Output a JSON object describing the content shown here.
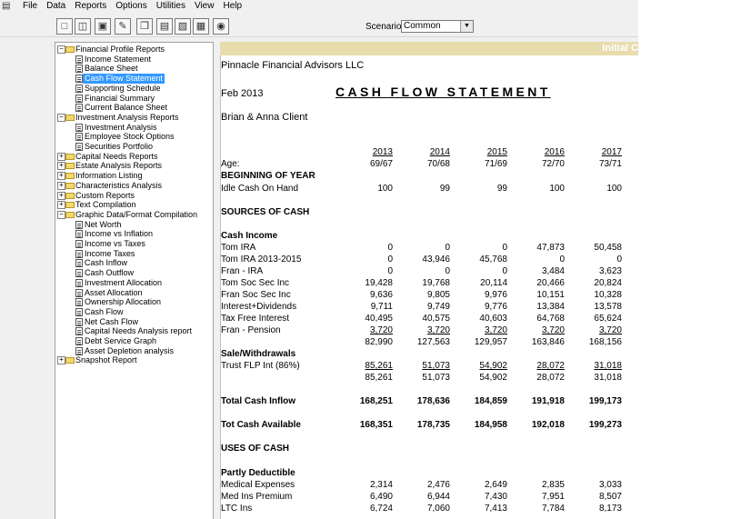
{
  "menu": {
    "app_icon": "app-icon",
    "items": [
      "File",
      "Data",
      "Reports",
      "Options",
      "Utilities",
      "View",
      "Help"
    ]
  },
  "toolbar": {
    "buttons": [
      "new-icon",
      "open-icon",
      "save-icon",
      "edit-icon",
      "copy-icon",
      "report-icon",
      "export-icon",
      "camera-icon"
    ]
  },
  "scenario": {
    "label": "Scenario:",
    "value": "Common"
  },
  "tree": [
    {
      "label": "Financial Profile Reports",
      "level": 0,
      "type": "folder",
      "toggle": "−"
    },
    {
      "label": "Income Statement",
      "level": 1,
      "type": "doc"
    },
    {
      "label": "Balance Sheet",
      "level": 1,
      "type": "doc"
    },
    {
      "label": "Cash Flow Statement",
      "level": 1,
      "type": "doc",
      "selected": true
    },
    {
      "label": "Supporting Schedule",
      "level": 1,
      "type": "doc"
    },
    {
      "label": "Financial Summary",
      "level": 1,
      "type": "doc"
    },
    {
      "label": "Current Balance Sheet",
      "level": 1,
      "type": "doc"
    },
    {
      "label": "Investment Analysis Reports",
      "level": 0,
      "type": "folder",
      "toggle": "−"
    },
    {
      "label": "Investment Analysis",
      "level": 1,
      "type": "doc"
    },
    {
      "label": "Employee Stock Options",
      "level": 1,
      "type": "doc"
    },
    {
      "label": "Securities Portfolio",
      "level": 1,
      "type": "doc"
    },
    {
      "label": "Capital Needs Reports",
      "level": 0,
      "type": "folder",
      "toggle": "+"
    },
    {
      "label": "Estate Analysis Reports",
      "level": 0,
      "type": "folder",
      "toggle": "+"
    },
    {
      "label": "Information Listing",
      "level": 0,
      "type": "folder",
      "toggle": "+"
    },
    {
      "label": "Characteristics Analysis",
      "level": 0,
      "type": "folder",
      "toggle": "+"
    },
    {
      "label": "Custom Reports",
      "level": 0,
      "type": "folder",
      "toggle": "+"
    },
    {
      "label": "Text Compilation",
      "level": 0,
      "type": "folder",
      "toggle": "+"
    },
    {
      "label": "Graphic Data/Format Compilation",
      "level": 0,
      "type": "folder",
      "toggle": "−"
    },
    {
      "label": "Net Worth",
      "level": 1,
      "type": "doc"
    },
    {
      "label": "Income vs Inflation",
      "level": 1,
      "type": "doc"
    },
    {
      "label": "Income vs Taxes",
      "level": 1,
      "type": "doc"
    },
    {
      "label": "Income Taxes",
      "level": 1,
      "type": "doc"
    },
    {
      "label": "Cash Inflow",
      "level": 1,
      "type": "doc"
    },
    {
      "label": "Cash Outflow",
      "level": 1,
      "type": "doc"
    },
    {
      "label": "Investment Allocation",
      "level": 1,
      "type": "doc"
    },
    {
      "label": "Asset Allocation",
      "level": 1,
      "type": "doc"
    },
    {
      "label": "Ownership Allocation",
      "level": 1,
      "type": "doc"
    },
    {
      "label": "Cash Flow",
      "level": 1,
      "type": "doc"
    },
    {
      "label": "Net Cash Flow",
      "level": 1,
      "type": "doc"
    },
    {
      "label": "Capital Needs Analysis report",
      "level": 1,
      "type": "doc"
    },
    {
      "label": "Debt Service Graph",
      "level": 1,
      "type": "doc"
    },
    {
      "label": "Asset Depletion analysis",
      "level": 1,
      "type": "doc"
    },
    {
      "label": "Snapshot Report",
      "level": 0,
      "type": "folder",
      "toggle": "+"
    }
  ],
  "report": {
    "banner": "Initial C",
    "firm": "Pinnacle Financial Advisors LLC",
    "date": "Feb 2013",
    "title": "CASH FLOW STATEMENT",
    "client": "Brian & Anna Client",
    "age_label": "Age:",
    "years": [
      "2013",
      "2014",
      "2015",
      "2016",
      "2017"
    ],
    "ages": [
      "69/67",
      "70/68",
      "71/69",
      "72/70",
      "73/71"
    ],
    "rows": [
      {
        "kind": "label",
        "text": "BEGINNING OF YEAR",
        "bold": true
      },
      {
        "kind": "row",
        "text": "Idle Cash On Hand",
        "values": [
          "100",
          "99",
          "99",
          "100",
          "100"
        ]
      },
      {
        "kind": "section",
        "text": "SOURCES OF CASH"
      },
      {
        "kind": "label",
        "text": "Cash Income",
        "bold": true
      },
      {
        "kind": "row",
        "text": "Tom IRA",
        "values": [
          "0",
          "0",
          "0",
          "47,873",
          "50,458"
        ]
      },
      {
        "kind": "row",
        "text": "Tom IRA 2013-2015",
        "values": [
          "0",
          "43,946",
          "45,768",
          "0",
          "0"
        ]
      },
      {
        "kind": "row",
        "text": "Fran - IRA",
        "values": [
          "0",
          "0",
          "0",
          "3,484",
          "3,623"
        ]
      },
      {
        "kind": "row",
        "text": "Tom Soc Sec Inc",
        "values": [
          "19,428",
          "19,768",
          "20,114",
          "20,466",
          "20,824"
        ]
      },
      {
        "kind": "row",
        "text": "Fran Soc Sec Inc",
        "values": [
          "9,636",
          "9,805",
          "9,976",
          "10,151",
          "10,328"
        ]
      },
      {
        "kind": "row",
        "text": "Interest+Dividends",
        "values": [
          "9,711",
          "9,749",
          "9,776",
          "13,384",
          "13,578"
        ]
      },
      {
        "kind": "row",
        "text": "Tax Free Interest",
        "values": [
          "40,495",
          "40,575",
          "40,603",
          "64,768",
          "65,624"
        ]
      },
      {
        "kind": "row",
        "text": "Fran - Pension",
        "values": [
          "3,720",
          "3,720",
          "3,720",
          "3,720",
          "3,720"
        ],
        "underline": true
      },
      {
        "kind": "row",
        "text": "",
        "values": [
          "82,990",
          "127,563",
          "129,957",
          "163,846",
          "168,156"
        ]
      },
      {
        "kind": "label",
        "text": "Sale/Withdrawals",
        "bold": true
      },
      {
        "kind": "row",
        "text": "Trust FLP Int (86%)",
        "values": [
          "85,261",
          "51,073",
          "54,902",
          "28,072",
          "31,018"
        ],
        "underline": true
      },
      {
        "kind": "row",
        "text": "",
        "values": [
          "85,261",
          "51,073",
          "54,902",
          "28,072",
          "31,018"
        ]
      },
      {
        "kind": "row",
        "text": "Total Cash Inflow",
        "values": [
          "168,251",
          "178,636",
          "184,859",
          "191,918",
          "199,173"
        ],
        "bold": true
      },
      {
        "kind": "row",
        "text": "Tot Cash Available",
        "values": [
          "168,351",
          "178,735",
          "184,958",
          "192,018",
          "199,273"
        ],
        "bold": true
      },
      {
        "kind": "section",
        "text": "USES OF CASH"
      },
      {
        "kind": "label",
        "text": "Partly Deductible",
        "bold": true
      },
      {
        "kind": "row",
        "text": "Medical Expenses",
        "values": [
          "2,314",
          "2,476",
          "2,649",
          "2,835",
          "3,033"
        ]
      },
      {
        "kind": "row",
        "text": "Med Ins Premium",
        "values": [
          "6,490",
          "6,944",
          "7,430",
          "7,951",
          "8,507"
        ]
      },
      {
        "kind": "row",
        "text": "LTC Ins",
        "values": [
          "6,724",
          "7,060",
          "7,413",
          "7,784",
          "8,173"
        ]
      }
    ]
  }
}
